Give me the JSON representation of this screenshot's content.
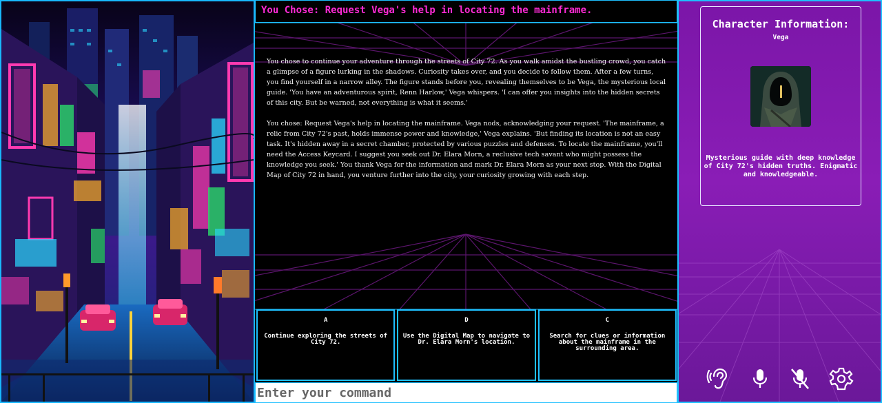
{
  "header": {
    "title": "You Chose: Request Vega's help in locating the mainframe."
  },
  "story": {
    "paragraphs": [
      "You chose to continue your adventure through the streets of City 72. As you walk amidst the bustling crowd, you catch a glimpse of a figure lurking in the shadows. Curiosity takes over, and you decide to follow them. After a few turns, you find yourself in a narrow alley. The figure stands before you, revealing themselves to be Vega, the mysterious local guide. 'You have an adventurous spirit, Renn Harlow,' Vega whispers. 'I can offer you insights into the hidden secrets of this city. But be warned, not everything is what it seems.'",
      "You chose: Request Vega's help in locating the mainframe. Vega nods, acknowledging your request. 'The mainframe, a relic from City 72's past, holds immense power and knowledge,' Vega explains. 'But finding its location is not an easy task. It's hidden away in a secret chamber, protected by various puzzles and defenses. To locate the mainframe, you'll need the Access Keycard. I suggest you seek out Dr. Elara Morn, a reclusive tech savant who might possess the knowledge you seek.' You thank Vega for the information and mark Dr. Elara Morn as your next stop. With the Digital Map of City 72 in hand, you venture further into the city, your curiosity growing with each step."
    ]
  },
  "choices": [
    {
      "letter": "A",
      "text": "Continue exploring the streets of City 72."
    },
    {
      "letter": "D",
      "text": "Use the Digital Map to navigate to Dr. Elara Morn's location."
    },
    {
      "letter": "C",
      "text": "Search for clues or information about the mainframe in the surrounding area."
    }
  ],
  "command": {
    "placeholder": "Enter your command"
  },
  "character": {
    "title": "Character Information:",
    "name": "Vega",
    "description": "Mysterious guide with deep knowledge of City 72's hidden truths. Enigmatic and knowledgeable."
  },
  "controls": {
    "icons": [
      "ear-icon",
      "microphone-icon",
      "microphone-muted-icon",
      "gear-icon"
    ]
  },
  "colors": {
    "accent_cyan": "#1ec0ff",
    "header_magenta": "#ff2bd6",
    "panel_purple": "#8a1db6"
  }
}
